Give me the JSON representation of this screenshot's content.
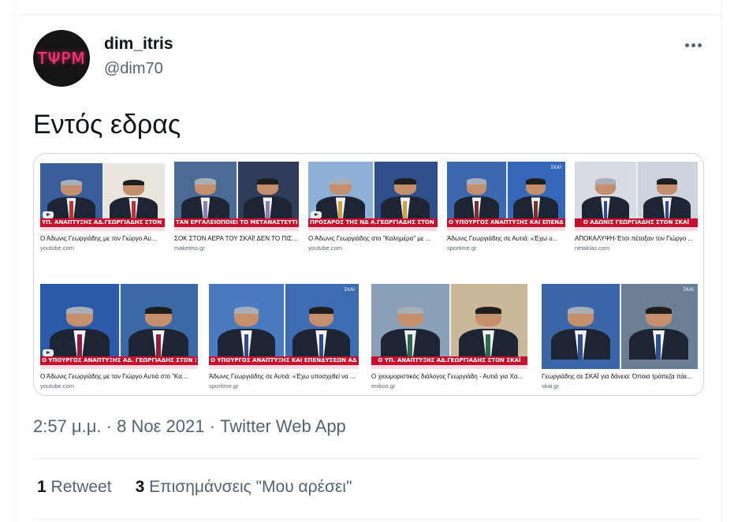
{
  "author": {
    "display_name": "dim_itris",
    "handle": "@dim70",
    "avatar_text": "ΤΨΡΜ"
  },
  "tweet": {
    "text": "Εντός εδρας"
  },
  "images": [
    {
      "title": "Ο Άδωνις Γεωργιάδης με τον Γιώργο Αυ...",
      "source": "youtube.com",
      "banner": "ΥΠ. ΑΝΑΠΤΥΞΗΣ ΑΔ.ΓΕΩΡΓΙΑΔΗΣ ΣΤΟΝ ΣΚΑΪ",
      "logo": "",
      "has_play": true
    },
    {
      "title": "ΣΟΚ ΣΤΟΝ ΑΕΡΑ ΤΟΥ ΣΚΑΪ! ΔΕΝ ΤΟ ΠΙΣΤ...",
      "source": "makeleio.gr",
      "banner": "ΤΑΝ ΕΡΓΑΛΕΙΟΠΟΙΕΙ ΤΟ ΜΕΤΑΝΑΣΤΕΥΤΙΚΟ ΓΙΑ ΠΟΛΙΤΙΚΟΥΣ ΛΟΓΟΥΣ",
      "logo": "",
      "has_play": false
    },
    {
      "title": "Ο Άδωνις Γεωργιάδης στο \"Καλημέρα\" με ...",
      "source": "youtube.com",
      "banner": "ΠΡΟΣΑΡΟΣ ΤΗΣ ΝΔ Α.ΓΕΩΡΓΙΑΔΗΣ ΣΤΟΝ ΣΚΑΪ",
      "logo": "",
      "has_play": true
    },
    {
      "title": "Άδωνις Γεωργιάδης σε Αυτιά: «Έχω υ...",
      "source": "sportime.gr",
      "banner": "Ο ΥΠΟΥΡΓΟΣ ΑΝΑΠΤΥΞΗΣ ΚΑΙ ΕΠΕΝΔΥΣΕΩΝ ΣΤΟΝ ΣΚΑΪ",
      "logo": "ΣΚΑΪ",
      "has_play": false
    },
    {
      "title": "ΑΠΟΚΑΛΥΨΗ-Έτσι πέταξαν τον Γιώργο ...",
      "source": "netakias.com",
      "banner": "Ο ΑΔΩΝΙΣ ΓΕΩΡΓΙΑΔΗΣ ΣΤΟΝ ΣΚΑΪ",
      "logo": "",
      "has_play": false
    },
    {
      "title": "Ο Άδωνις Γεωργιάδης με τον Γιώργο Αυτιά στο \"Κα...",
      "source": "youtube.com",
      "banner": "Ο ΥΠΟΥΡΓΟΣ ΑΝΑΠΤΥΞΗΣ ΑΔ. ΓΕΩΡΓΙΑΔΗΣ ΣΤΟΝ ΣΚΑΪ",
      "logo": "",
      "has_play": true
    },
    {
      "title": "Άδωνις Γεωργιάδης σε Αυτιά: «Έχω υποσχεθεί να ...",
      "source": "sportime.gr",
      "banner": "Ο ΥΠΟΥΡΓΟΣ ΑΝΑΠΤΥΞΗΣ ΚΑΙ ΕΠΕΝΔΥΣΕΩΝ ΑΔ.ΓΕΩΡΓΙΑΔΗΣ ΣΤΟΝ ΣΚΑΪ",
      "logo": "ΣΚΑΪ",
      "has_play": false
    },
    {
      "title": "Ο χιουμοριστικός διάλογος Γεωργιάδη - Αυτιά για Χα...",
      "source": "enikos.gr",
      "banner": "Ο ΥΠ. ΑΝΑΠΤΥΞΗΣ ΑΔ.ΓΕΩΡΓΙΑΔΗΣ ΣΤΟΝ ΣΚΑΪ",
      "logo": "",
      "has_play": false
    },
    {
      "title": "Γεωργιάδης σε ΣΚΑΪ για δάνεια: Όποια τράπεζα πάε...",
      "source": "skai.gr",
      "banner": "",
      "logo": "ΣΚΑΪ",
      "has_play": false
    }
  ],
  "meta": {
    "time": "2:57 μ.μ.",
    "date": "8 Νοε 2021",
    "app": "Twitter Web App",
    "separator": "·"
  },
  "stats": {
    "retweets_count": "1",
    "retweets_label": "Retweet",
    "likes_count": "3",
    "likes_label": "Επισημάνσεις \"Μου αρέσει\""
  },
  "colors": {
    "text_primary": "#0f1419",
    "text_secondary": "#536471",
    "banner_red": "#c8102e",
    "border": "#cfd9de"
  }
}
